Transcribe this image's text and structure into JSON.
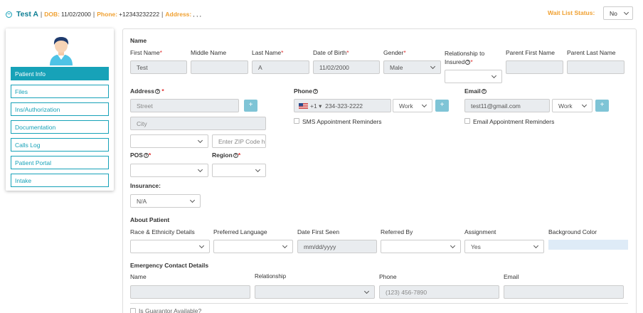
{
  "header": {
    "patient_name": "Test A",
    "dob_label": "DOB:",
    "dob_value": "11/02/2000",
    "phone_label": "Phone:",
    "phone_value": "+12343232222",
    "address_label": "Address:",
    "address_value": ", , ,",
    "separator": "|",
    "wait_list_label": "Wait List Status:",
    "wait_list_value": "No"
  },
  "sidebar": {
    "items": [
      {
        "label": "Patient Info",
        "active": true
      },
      {
        "label": "Files"
      },
      {
        "label": "Ins/Authorization"
      },
      {
        "label": "Documentation"
      },
      {
        "label": "Calls Log"
      },
      {
        "label": "Patient Portal"
      },
      {
        "label": "Intake"
      }
    ]
  },
  "name_section": {
    "title": "Name",
    "first_name_label": "First Name",
    "first_name_value": "Test",
    "middle_name_label": "Middle Name",
    "middle_name_value": "",
    "last_name_label": "Last Name",
    "last_name_value": "A",
    "dob_label": "Date of Birth",
    "dob_value": "11/02/2000",
    "gender_label": "Gender",
    "gender_value": "Male",
    "relationship_label_1": "Relationship to",
    "relationship_label_2": "Insured",
    "relationship_value": "",
    "parent_first_label": "Parent First Name",
    "parent_first_value": "",
    "parent_last_label": "Parent Last Name",
    "parent_last_value": ""
  },
  "address": {
    "label": "Address",
    "street_placeholder": "Street",
    "city_placeholder": "City",
    "state_value": "",
    "zip_placeholder": "Enter ZIP Code h",
    "pos_label": "POS",
    "pos_value": "",
    "region_label": "Region",
    "region_value": "",
    "insurance_label": "Insurance:",
    "insurance_value": "N/A",
    "plus_label": "+"
  },
  "phone": {
    "label": "Phone",
    "country_code": "+1",
    "country_arrow": "▾",
    "number": "234-323-2222",
    "type": "Work",
    "sms_label": "SMS Appointment Reminders",
    "plus_label": "+"
  },
  "email": {
    "label": "Email",
    "value": "test11@gmail.com",
    "type": "Work",
    "reminders_label": "Email Appointment Reminders",
    "plus_label": "+"
  },
  "about": {
    "title": "About Patient",
    "race_label": "Race & Ethnicity Details",
    "race_value": "",
    "language_label": "Preferred Language",
    "language_value": "",
    "date_first_seen_label": "Date First Seen",
    "date_first_seen_placeholder": "mm/dd/yyyy",
    "referred_by_label": "Referred By",
    "referred_by_value": "",
    "assignment_label": "Assignment",
    "assignment_value": "Yes",
    "background_color_label": "Background Color",
    "background_color": "#deebf7"
  },
  "emergency": {
    "title": "Emergency Contact Details",
    "name_label": "Name",
    "name_value": "",
    "relationship_label": "Relationship",
    "relationship_value": "",
    "phone_label": "Phone",
    "phone_placeholder": "(123) 456-7890",
    "email_label": "Email",
    "email_value": ""
  },
  "guarantor": {
    "label": "Is Guarantor Available?"
  },
  "colors": {
    "accent": "#17a2b8",
    "header_label": "#f0a030",
    "required": "#e03030"
  },
  "icons": {
    "collapse": "minus-circle-icon",
    "help": "question-circle-icon",
    "flag": "us-flag-icon",
    "dropdown": "chevron-down-icon",
    "add": "plus-icon",
    "avatar": "user-avatar-icon"
  }
}
